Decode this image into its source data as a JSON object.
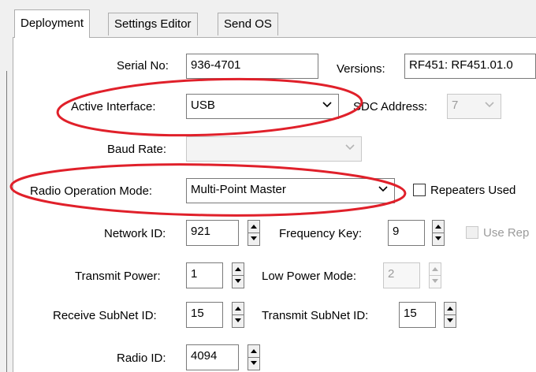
{
  "tabs": [
    {
      "label": "Deployment",
      "active": true
    },
    {
      "label": "Settings Editor",
      "active": false
    },
    {
      "label": "Send OS",
      "active": false
    }
  ],
  "serial_no": {
    "label": "Serial No:",
    "value": "936-4701"
  },
  "versions": {
    "label": "Versions:",
    "value": "RF451: RF451.01.0"
  },
  "active_interface": {
    "label": "Active Interface:",
    "value": "USB"
  },
  "sdc_address": {
    "label": "SDC Address:",
    "value": "7"
  },
  "baud_rate": {
    "label": "Baud Rate:",
    "value": ""
  },
  "radio_operation_mode": {
    "label": "Radio Operation Mode:",
    "value": "Multi-Point Master"
  },
  "repeaters_used": {
    "label": "Repeaters Used",
    "checked": false
  },
  "network_id": {
    "label": "Network ID:",
    "value": "921"
  },
  "frequency_key": {
    "label": "Frequency Key:",
    "value": "9"
  },
  "use_repeater": {
    "label": "Use Rep",
    "checked": false
  },
  "transmit_power": {
    "label": "Transmit Power:",
    "value": "1"
  },
  "low_power_mode": {
    "label": "Low Power Mode:",
    "value": "2"
  },
  "receive_subnet_id": {
    "label": "Receive SubNet ID:",
    "value": "15"
  },
  "transmit_subnet_id": {
    "label": "Transmit SubNet ID:",
    "value": "15"
  },
  "radio_id": {
    "label": "Radio ID:",
    "value": "4094"
  },
  "colors": {
    "annotation_red": "#e0202a",
    "border": "#7a7a7a",
    "window_bg": "#f0f0f0"
  }
}
